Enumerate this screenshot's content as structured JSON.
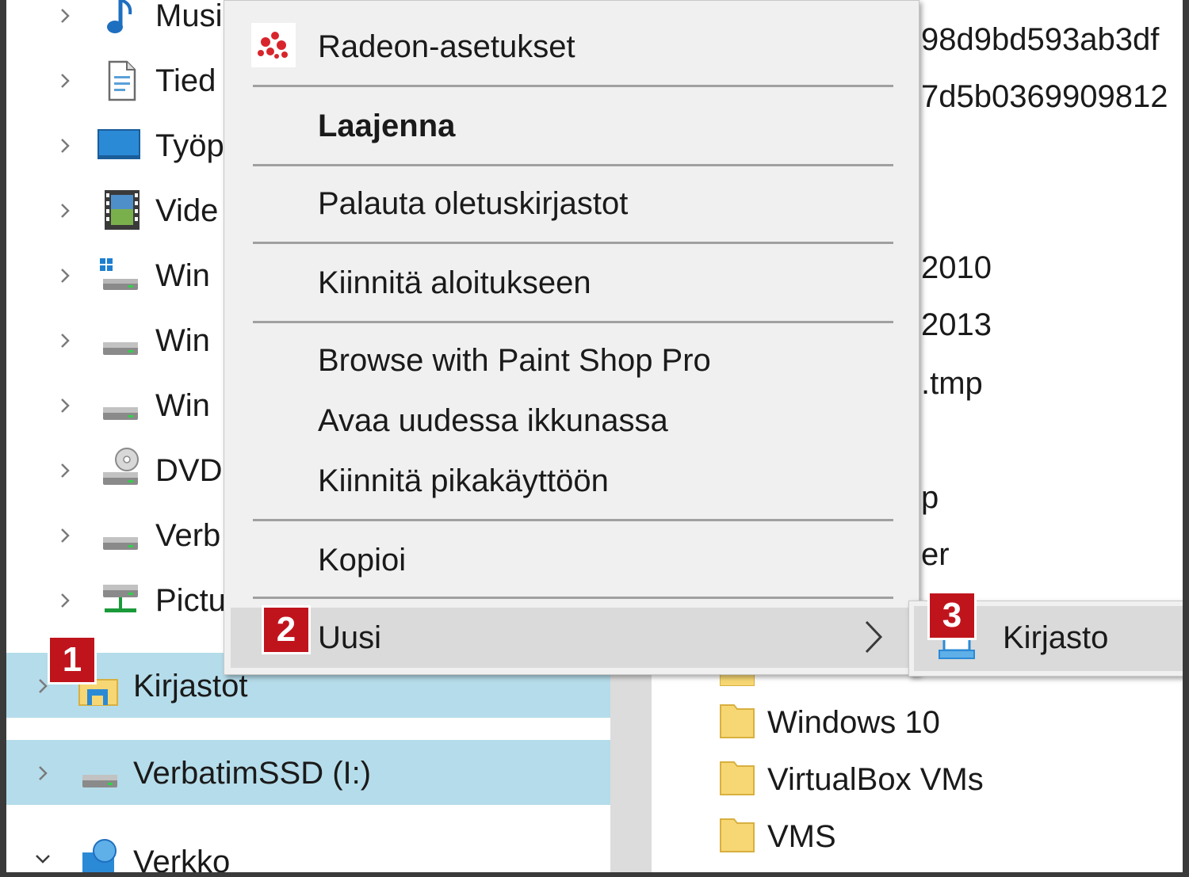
{
  "nav_tree": {
    "items": [
      {
        "label": "Musi",
        "icon": "music-note-icon"
      },
      {
        "label": "Tied",
        "icon": "document-icon"
      },
      {
        "label": "Työp",
        "icon": "desktop-icon"
      },
      {
        "label": "Vide",
        "icon": "video-film-icon"
      },
      {
        "label": "Win",
        "icon": "windows-drive-icon"
      },
      {
        "label": "Win",
        "icon": "drive-icon"
      },
      {
        "label": "Win",
        "icon": "drive-icon"
      },
      {
        "label": "DVD-",
        "icon": "dvd-drive-icon"
      },
      {
        "label": "Verb",
        "icon": "drive-icon"
      },
      {
        "label": "Pictu",
        "icon": "network-drive-icon"
      }
    ],
    "libraries": {
      "label": "Kirjastot",
      "icon": "libraries-icon"
    },
    "verbatim": {
      "label": "VerbatimSSD (I:)",
      "icon": "drive-icon"
    },
    "network": {
      "label": "Verkko",
      "icon": "network-icon"
    }
  },
  "content": {
    "partial_lines": [
      "98d9bd593ab3df",
      "7d5b0369909812",
      "2010",
      "2013",
      ".tmp",
      "p",
      "er"
    ],
    "folders": [
      {
        "name": "Windows 10"
      },
      {
        "name": "VirtualBox VMs"
      },
      {
        "name": "VMS"
      }
    ]
  },
  "context_menu": {
    "items": {
      "radeon": "Radeon-asetukset",
      "expand": "Laajenna",
      "restore_libraries": "Palauta oletuskirjastot",
      "pin_start": "Kiinnitä aloitukseen",
      "browse_psp": "Browse with Paint Shop Pro",
      "open_new_window": "Avaa uudessa ikkunassa",
      "pin_quick_access": "Kiinnitä pikakäyttöön",
      "copy": "Kopioi",
      "new": "Uusi"
    }
  },
  "submenu": {
    "library": "Kirjasto"
  },
  "markers": {
    "one": "1",
    "two": "2",
    "three": "3"
  },
  "colors": {
    "selection": "#b5dcea",
    "menu_bg": "#f0f0f0",
    "menu_hover": "#dadada",
    "marker_red": "#c0141c",
    "folder_yellow": "#f7d774"
  }
}
